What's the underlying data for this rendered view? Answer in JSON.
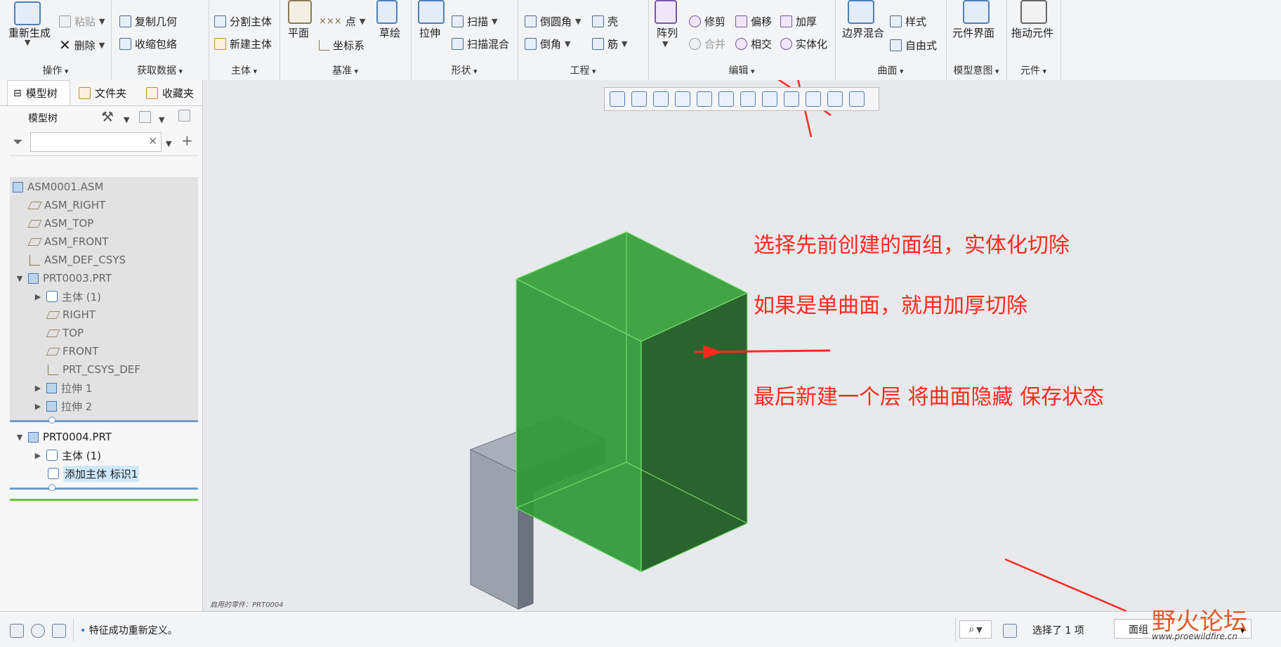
{
  "ribbon": {
    "groups": {
      "operations": "操作",
      "get_data": "获取数据",
      "body": "主体",
      "datum": "基准",
      "shapes": "形状",
      "engineering": "工程",
      "editing": "编辑",
      "surfaces": "曲面",
      "model_intent": "模型意图",
      "components": "元件"
    },
    "buttons": {
      "regenerate": "重新生成",
      "paste": "粘贴",
      "delete": "删除",
      "copy_geometry": "复制几何",
      "shrinkwrap": "收缩包络",
      "split_body": "分割主体",
      "new_body": "新建主体",
      "plane": "平面",
      "point": "点",
      "coordinate_system": "坐标系",
      "sketch": "草绘",
      "extrude": "拉伸",
      "sweep": "扫描",
      "swept_blend": "扫描混合",
      "round": "倒圆角",
      "chamfer": "倒角",
      "shell": "壳",
      "rib": "筋",
      "pattern": "阵列",
      "trim": "修剪",
      "offset": "偏移",
      "thicken": "加厚",
      "merge": "合并",
      "intersect": "相交",
      "solidify": "实体化",
      "boundary_blend": "边界混合",
      "style": "样式",
      "freestyle": "自由式",
      "component_interface": "元件界面",
      "drag_components": "拖动元件"
    }
  },
  "left_panel": {
    "tabs": [
      "模型树",
      "文件夹",
      "收藏夹"
    ],
    "model_tree_label": "模型树",
    "filter_placeholder": "",
    "tree": [
      {
        "label": "ASM0001.ASM"
      },
      {
        "label": "ASM_RIGHT"
      },
      {
        "label": "ASM_TOP"
      },
      {
        "label": "ASM_FRONT"
      },
      {
        "label": "ASM_DEF_CSYS"
      },
      {
        "label": "PRT0003.PRT"
      },
      {
        "label": "主体 (1)"
      },
      {
        "label": "RIGHT"
      },
      {
        "label": "TOP"
      },
      {
        "label": "FRONT"
      },
      {
        "label": "PRT_CSYS_DEF"
      },
      {
        "label": "拉伸 1"
      },
      {
        "label": "拉伸 2"
      },
      {
        "label": "PRT0004.PRT"
      },
      {
        "label": "主体 (1)"
      },
      {
        "label": "添加主体 标识1"
      }
    ]
  },
  "viewport": {
    "annotations": [
      "选择先前创建的面组，实体化切除",
      "如果是单曲面，就用加厚切除",
      "最后新建一个层  将曲面隐藏 保存状态"
    ],
    "active_part_label": "启用的零件：PRT0004"
  },
  "status_bar": {
    "message": "特征成功重新定义。",
    "selection": "选择了 1 项",
    "filter_value": "面组"
  },
  "watermark": {
    "title": "野火论坛",
    "url": "www.proewildfire.cn"
  },
  "colors": {
    "annotation": "#ff2a1e",
    "solid_green": "#2f9a39",
    "selection_highlight": "#cfe8fb"
  }
}
